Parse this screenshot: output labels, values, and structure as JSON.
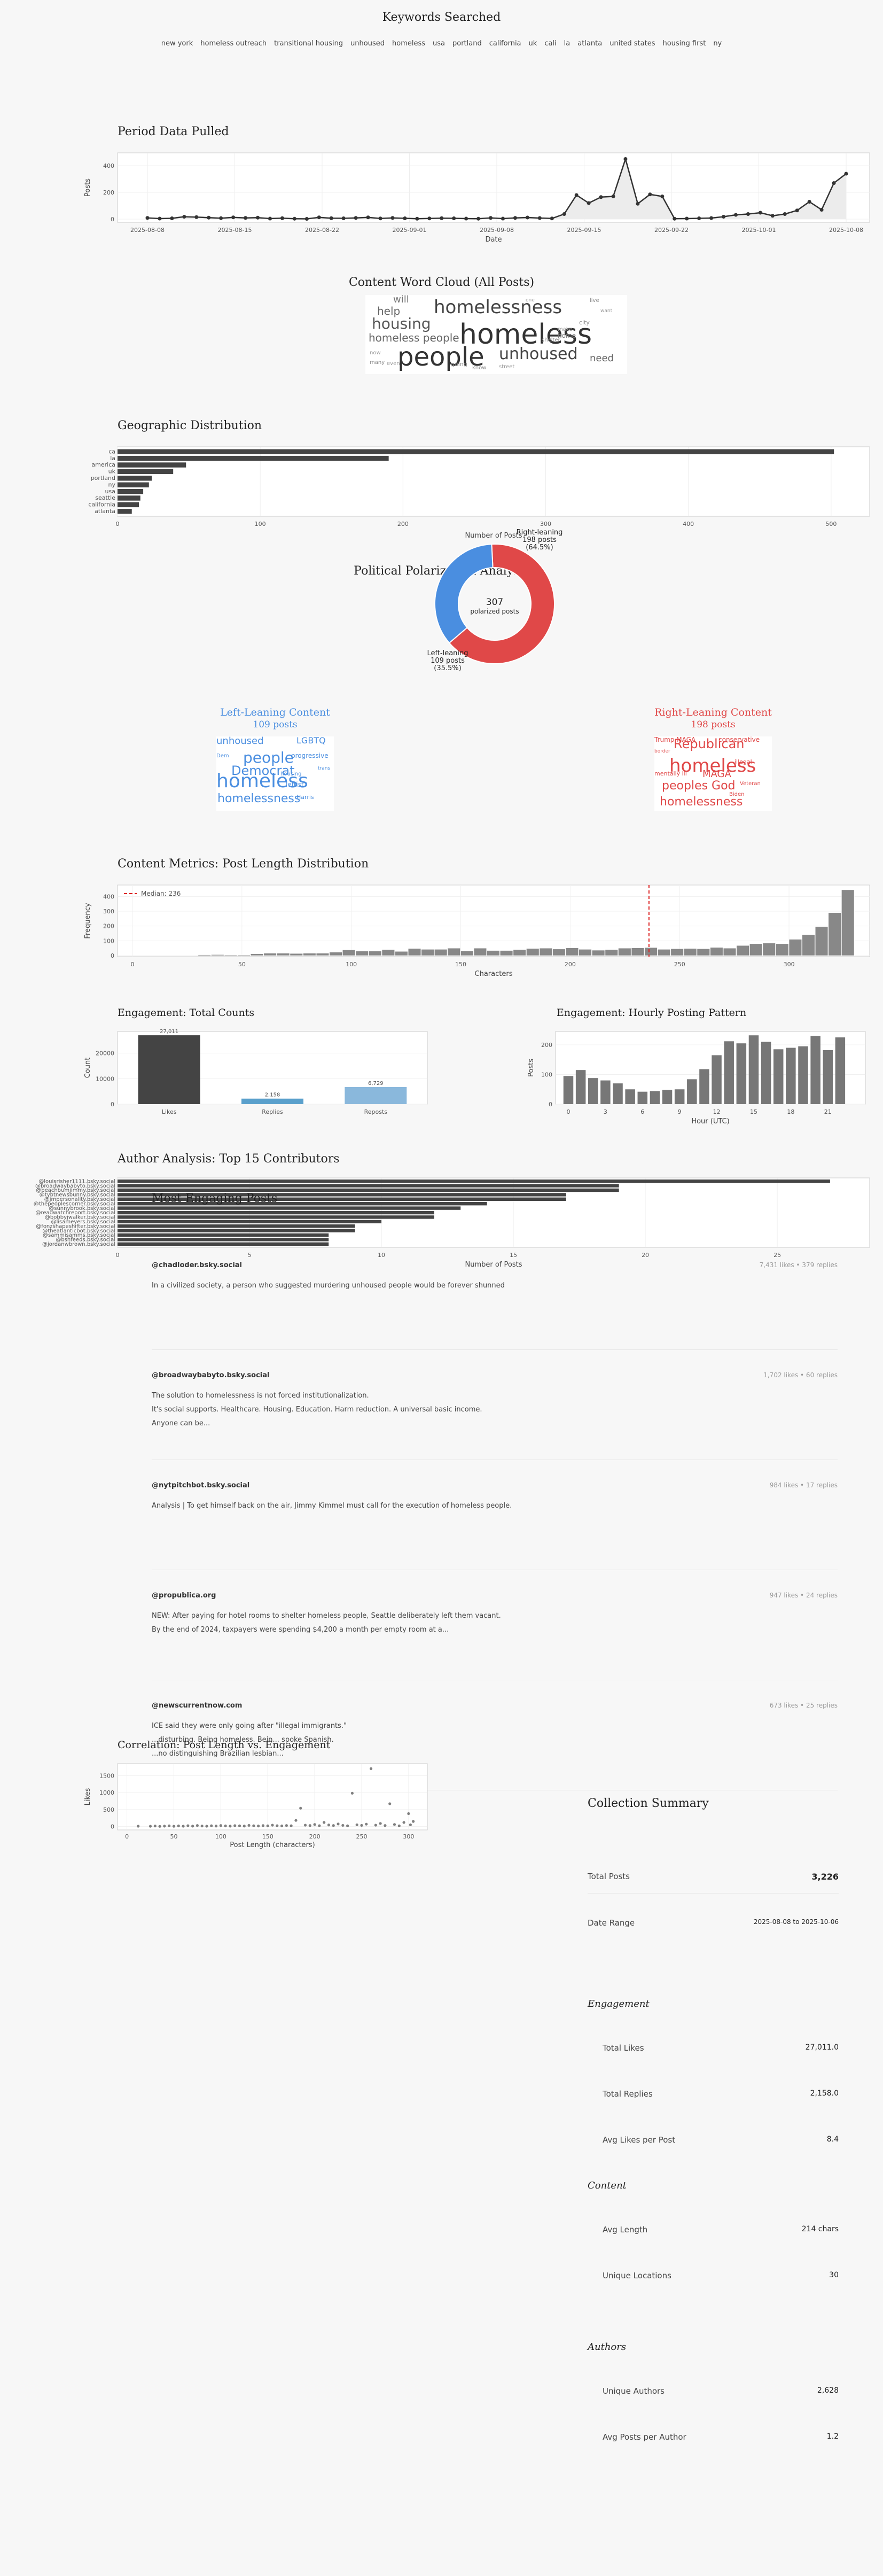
{
  "keywords_title": "Keywords Searched",
  "keywords": [
    "new york",
    "homeless outreach",
    "transitional housing",
    "unhoused",
    "homeless",
    "usa",
    "portland",
    "california",
    "uk",
    "cali",
    "la",
    "atlanta",
    "united states",
    "housing first",
    "ny"
  ],
  "period": {
    "title": "Period Data Pulled",
    "chart_data": {
      "type": "line",
      "xlabel": "Date",
      "ylabel": "Posts",
      "x_ticks": [
        "2025-08-08",
        "2025-08-15",
        "2025-08-22",
        "2025-09-01",
        "2025-09-08",
        "2025-09-15",
        "2025-09-22",
        "2025-10-01",
        "2025-10-08"
      ],
      "y_ticks": [
        0,
        200,
        400
      ],
      "ylim": [
        0,
        480
      ],
      "values": [
        9,
        4,
        6,
        18,
        15,
        11,
        7,
        13,
        9,
        11,
        4,
        7,
        3,
        2,
        13,
        7,
        6,
        9,
        13,
        5,
        9,
        6,
        3,
        5,
        7,
        6,
        4,
        3,
        9,
        4,
        9,
        12,
        8,
        5,
        38,
        180,
        120,
        165,
        170,
        450,
        115,
        185,
        170,
        3,
        4,
        6,
        8,
        18,
        32,
        38,
        48,
        25,
        38,
        65,
        130,
        70,
        270,
        340
      ]
    }
  },
  "wordcloud_all": {
    "title": "Content Word Cloud (All Posts)",
    "words": [
      {
        "t": "homeless",
        "s": 52,
        "c": "#333"
      },
      {
        "t": "people",
        "s": 48,
        "c": "#333"
      },
      {
        "t": "homelessness",
        "s": 34,
        "c": "#444"
      },
      {
        "t": "unhoused",
        "s": 30,
        "c": "#444"
      },
      {
        "t": "housing",
        "s": 28,
        "c": "#555"
      },
      {
        "t": "homeless people",
        "s": 20,
        "c": "#666"
      },
      {
        "t": "help",
        "s": 20,
        "c": "#666"
      },
      {
        "t": "will",
        "s": 18,
        "c": "#777"
      },
      {
        "t": "need",
        "s": 18,
        "c": "#666"
      },
      {
        "t": "home",
        "s": 12,
        "c": "#777"
      },
      {
        "t": "going",
        "s": 11,
        "c": "#888"
      },
      {
        "t": "city",
        "s": 11,
        "c": "#888"
      },
      {
        "t": "know",
        "s": 10,
        "c": "#888"
      },
      {
        "t": "live",
        "s": 10,
        "c": "#888"
      },
      {
        "t": "many",
        "s": 10,
        "c": "#888"
      },
      {
        "t": "shelter",
        "s": 10,
        "c": "#888"
      },
      {
        "t": "make",
        "s": 10,
        "c": "#999"
      },
      {
        "t": "now",
        "s": 10,
        "c": "#999"
      },
      {
        "t": "street",
        "s": 10,
        "c": "#999"
      },
      {
        "t": "even",
        "s": 10,
        "c": "#999"
      },
      {
        "t": "want",
        "s": 9,
        "c": "#999"
      },
      {
        "t": "one",
        "s": 9,
        "c": "#999"
      }
    ]
  },
  "geo": {
    "title": "Geographic Distribution",
    "chart_data": {
      "type": "bar",
      "orientation": "horizontal",
      "categories": [
        "ca",
        "la",
        "america",
        "uk",
        "portland",
        "ny",
        "usa",
        "seattle",
        "california",
        "atlanta"
      ],
      "values": [
        502,
        190,
        48,
        39,
        24,
        22,
        18,
        16,
        15,
        10
      ],
      "xlabel": "Number of Posts",
      "x_ticks": [
        0,
        100,
        200,
        300,
        400,
        500
      ],
      "xlim": [
        0,
        527
      ]
    }
  },
  "polar": {
    "title": "Political Polarization Analysis",
    "chart_data": {
      "type": "pie",
      "slices": [
        {
          "label": "Right-leaning",
          "posts": "198 posts",
          "pct": "(64.5%)",
          "value": 198,
          "color": "#e04848"
        },
        {
          "label": "Left-leaning",
          "posts": "109 posts",
          "pct": "(35.5%)",
          "value": 109,
          "color": "#4a8ee0"
        }
      ],
      "center_value": "307",
      "center_label": "polarized posts"
    }
  },
  "left_cloud": {
    "title": "Left-Leaning Content",
    "subtitle": "109 posts",
    "color": "#4a8ee0",
    "words": [
      {
        "t": "homeless",
        "s": 36
      },
      {
        "t": "homelessness",
        "s": 22
      },
      {
        "t": "people",
        "s": 28
      },
      {
        "t": "Democrat",
        "s": 24
      },
      {
        "t": "unhoused",
        "s": 18
      },
      {
        "t": "LGBTQ",
        "s": 16
      },
      {
        "t": "progressive",
        "s": 12
      },
      {
        "t": "leftist",
        "s": 12
      },
      {
        "t": "Harris",
        "s": 11
      },
      {
        "t": "housing",
        "s": 10
      },
      {
        "t": "Dem",
        "s": 10
      },
      {
        "t": "trans",
        "s": 9
      }
    ]
  },
  "right_cloud": {
    "title": "Right-Leaning Content",
    "subtitle": "198 posts",
    "color": "#e04848",
    "words": [
      {
        "t": "homeless",
        "s": 34
      },
      {
        "t": "Republican",
        "s": 24
      },
      {
        "t": "peoples God",
        "s": 22
      },
      {
        "t": "homelessness",
        "s": 22
      },
      {
        "t": "MAGA",
        "s": 18
      },
      {
        "t": "Trump MAGA",
        "s": 12
      },
      {
        "t": "conservative",
        "s": 12
      },
      {
        "t": "illegal",
        "s": 11
      },
      {
        "t": "mentally ill",
        "s": 11
      },
      {
        "t": "Biden",
        "s": 10
      },
      {
        "t": "Veteran",
        "s": 10
      },
      {
        "t": "border",
        "s": 9
      }
    ]
  },
  "length_hist": {
    "title": "Content Metrics: Post Length Distribution",
    "chart_data": {
      "type": "bar",
      "subtype": "histogram",
      "xlabel": "Characters",
      "ylabel": "Frequency",
      "bin_start": 0,
      "bin_width": 6,
      "values": [
        0,
        0,
        0,
        0,
        0,
        5,
        6,
        4,
        4,
        12,
        16,
        16,
        14,
        16,
        16,
        23,
        38,
        30,
        30,
        40,
        28,
        48,
        42,
        42,
        50,
        32,
        50,
        34,
        34,
        40,
        48,
        50,
        44,
        52,
        42,
        36,
        40,
        50,
        52,
        54,
        42,
        46,
        48,
        46,
        55,
        50,
        68,
        80,
        84,
        80,
        110,
        142,
        196,
        290,
        445
      ],
      "x_ticks": [
        0,
        50,
        100,
        150,
        200,
        250,
        300
      ],
      "y_ticks": [
        0,
        100,
        200,
        300,
        400
      ],
      "ylim": [
        0,
        470
      ],
      "xlim": [
        0,
        330
      ],
      "median": 236,
      "median_label": "Median: 236"
    }
  },
  "eng_totals": {
    "title": "Engagement: Total Counts",
    "chart_data": {
      "type": "bar",
      "categories": [
        "Likes",
        "Replies",
        "Reposts"
      ],
      "values": [
        27011,
        2158,
        6729
      ],
      "value_labels": [
        "27,011",
        "2,158",
        "6,729"
      ],
      "colors": [
        "#444444",
        "#5aa0cc",
        "#8ab8dc"
      ],
      "ylabel": "Count",
      "y_ticks": [
        0,
        10000,
        20000
      ],
      "ylim": [
        0,
        28500
      ]
    }
  },
  "hourly": {
    "title": "Engagement: Hourly Posting Pattern",
    "chart_data": {
      "type": "bar",
      "xlabel": "Hour (UTC)",
      "ylabel": "Posts",
      "categories": [
        0,
        1,
        2,
        3,
        4,
        5,
        6,
        7,
        8,
        9,
        10,
        11,
        12,
        13,
        14,
        15,
        16,
        17,
        18,
        19,
        20,
        21,
        22,
        23
      ],
      "values": [
        95,
        115,
        88,
        80,
        70,
        50,
        42,
        44,
        48,
        50,
        84,
        118,
        165,
        212,
        205,
        232,
        210,
        185,
        190,
        195,
        230,
        182,
        225,
        0
      ],
      "x_ticks": [
        0,
        3,
        6,
        9,
        12,
        15,
        18,
        21
      ],
      "y_ticks": [
        0,
        100,
        200
      ],
      "ylim": [
        0,
        245
      ]
    }
  },
  "authors": {
    "title": "Author Analysis: Top 15 Contributors",
    "chart_data": {
      "type": "bar",
      "orientation": "horizontal",
      "categories": [
        "@louisrisher1111.bsky.social",
        "@broadwaybabyto.bsky.social",
        "@beachbumjimmy.bsky.social",
        "@tybtnewsbunny.bsky.social",
        "@jmpersonality.bsky.social",
        "@thepeoplescorner.bsky.social",
        "@sunnybrook.bsky.social",
        "@readwatchreport.bsky.social",
        "@bobbyjwalker.bsky.social",
        "@lisameyers.bsky.social",
        "@fonzshapeshifter.bsky.social",
        "@theatlanticbot.bsky.social",
        "@sammisamms.bsky.social",
        "@bshfeeds.bsky.social",
        "@jordanwbrown.bsky.social"
      ],
      "values": [
        27,
        19,
        19,
        17,
        17,
        14,
        13,
        12,
        12,
        10,
        9,
        9,
        8,
        8,
        8
      ],
      "xlabel": "Number of Posts",
      "x_ticks": [
        0,
        5,
        10,
        15,
        20,
        25
      ],
      "xlim": [
        0,
        28.5
      ]
    }
  },
  "top_posts": {
    "title": "Most Engaging Posts",
    "items": [
      {
        "author": "@chadloder.bsky.social",
        "meta": "7,431 likes  •  379 replies",
        "lines": [
          "In a civilized society, a person who suggested murdering unhoused people would be forever shunned"
        ]
      },
      {
        "author": "@broadwaybabyto.bsky.social",
        "meta": "1,702 likes  •  60 replies",
        "lines": [
          "The solution to homelessness is not forced institutionalization.",
          "It's social supports. Healthcare. Housing. Education. Harm reduction. A universal basic income.",
          "Anyone can be..."
        ]
      },
      {
        "author": "@nytpitchbot.bsky.social",
        "meta": "984 likes  •  17 replies",
        "lines": [
          "Analysis | To get himself back on the air, Jimmy Kimmel must call for the execution of homeless people."
        ]
      },
      {
        "author": "@propublica.org",
        "meta": "947 likes  •  24 replies",
        "lines": [
          "NEW: After paying for hotel rooms to shelter homeless people, Seattle deliberately left them vacant.",
          "By the end of 2024, taxpayers were spending $4,200 a month per empty room at a..."
        ]
      },
      {
        "author": "@newscurrentnow.com",
        "meta": "673 likes  •  25 replies",
        "lines": [
          "ICE said they were only going after \"illegal immigrants.\"",
          "...disturbing. Being homeless. Bein... spoke Spanish.",
          "...no distinguishing Brazilian lesbian..."
        ]
      }
    ]
  },
  "correlation": {
    "title": "Correlation: Post Length vs. Engagement",
    "chart_data": {
      "type": "scatter",
      "xlabel": "Post Length (characters)",
      "ylabel": "Likes",
      "x_ticks": [
        0,
        50,
        100,
        150,
        200,
        250,
        300
      ],
      "y_ticks": [
        0,
        500,
        1000,
        1500
      ],
      "xlim": [
        -10,
        320
      ],
      "ylim": [
        -100,
        1850
      ],
      "points": [
        [
          12,
          10
        ],
        [
          25,
          8
        ],
        [
          30,
          15
        ],
        [
          35,
          5
        ],
        [
          40,
          12
        ],
        [
          45,
          20
        ],
        [
          50,
          8
        ],
        [
          55,
          18
        ],
        [
          60,
          10
        ],
        [
          65,
          25
        ],
        [
          70,
          12
        ],
        [
          75,
          30
        ],
        [
          80,
          15
        ],
        [
          85,
          10
        ],
        [
          90,
          22
        ],
        [
          95,
          14
        ],
        [
          100,
          30
        ],
        [
          105,
          18
        ],
        [
          110,
          12
        ],
        [
          115,
          26
        ],
        [
          120,
          20
        ],
        [
          125,
          14
        ],
        [
          130,
          35
        ],
        [
          135,
          22
        ],
        [
          140,
          16
        ],
        [
          145,
          28
        ],
        [
          150,
          20
        ],
        [
          155,
          40
        ],
        [
          160,
          25
        ],
        [
          165,
          18
        ],
        [
          170,
          30
        ],
        [
          175,
          22
        ],
        [
          180,
          180
        ],
        [
          185,
          540
        ],
        [
          190,
          40
        ],
        [
          195,
          30
        ],
        [
          200,
          60
        ],
        [
          205,
          25
        ],
        [
          210,
          120
        ],
        [
          215,
          45
        ],
        [
          220,
          30
        ],
        [
          225,
          75
        ],
        [
          230,
          35
        ],
        [
          235,
          20
        ],
        [
          240,
          980
        ],
        [
          245,
          50
        ],
        [
          250,
          35
        ],
        [
          255,
          70
        ],
        [
          260,
          1702
        ],
        [
          265,
          40
        ],
        [
          270,
          90
        ],
        [
          275,
          30
        ],
        [
          280,
          670
        ],
        [
          285,
          60
        ],
        [
          290,
          20
        ],
        [
          295,
          120
        ],
        [
          300,
          380
        ],
        [
          302,
          50
        ],
        [
          305,
          150
        ]
      ]
    }
  },
  "summary": {
    "title": "Collection Summary",
    "total_posts_label": "Total Posts",
    "total_posts": "3,226",
    "date_range_label": "Date Range",
    "date_range": "2025-08-08 to 2025-10-06",
    "engagement_head": "Engagement",
    "total_likes_label": "Total Likes",
    "total_likes": "27,011.0",
    "total_replies_label": "Total Replies",
    "total_replies": "2,158.0",
    "avg_likes_label": "Avg Likes per Post",
    "avg_likes": "8.4",
    "content_head": "Content",
    "avg_length_label": "Avg Length",
    "avg_length": "214 chars",
    "unique_loc_label": "Unique Locations",
    "unique_loc": "30",
    "authors_head": "Authors",
    "unique_authors_label": "Unique Authors",
    "unique_authors": "2,628",
    "avg_posts_author_label": "Avg Posts per Author",
    "avg_posts_author": "1.2"
  }
}
